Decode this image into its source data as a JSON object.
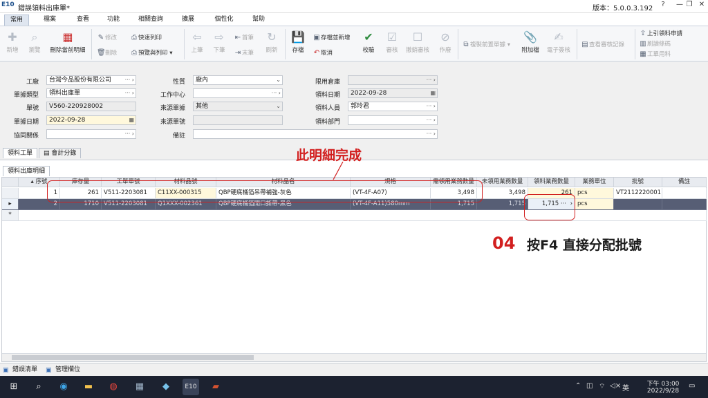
{
  "window": {
    "app_icon": "E10",
    "title": "錯誤領料出庫單*",
    "version": "版本：5.0.0.3.192",
    "controls": [
      "?",
      "—",
      "❐",
      "✕"
    ]
  },
  "ribbon_tabs": [
    "常用",
    "檔案",
    "查看",
    "功能",
    "相關查詢",
    "擴展",
    "個性化",
    "幫助"
  ],
  "toolbar": {
    "new": "新增",
    "browse": "瀏覽",
    "delete_current_detail": "刪除當前明細",
    "modify": "修改",
    "delete": "刪除",
    "quick_print": "快速列印",
    "preview_print": "預覽與列印",
    "prev": "上筆",
    "next": "下筆",
    "first": "首筆",
    "last": "末筆",
    "refresh": "刷新",
    "save": "存檔",
    "save_and_new": "存檔並新增",
    "cancel": "取消",
    "validate": "校驗",
    "review": "審核",
    "unreview": "撤銷審核",
    "void": "作廢",
    "copy_prev_doc": "複製前置單據",
    "attachment": "附加檔",
    "e_sign": "電子簽核",
    "view_review_log": "查看審核記錄",
    "prev_requisition": "上引領料申請",
    "scan_code": "刷讀條碼",
    "work_materials": "工單用料"
  },
  "form": {
    "factory_label": "工廠",
    "factory_value": "台灣今品股份有限公司",
    "doc_type_label": "單據類型",
    "doc_type_value": "領料出庫單",
    "doc_no_label": "單號",
    "doc_no_value": "V560-220928002",
    "doc_date_label": "單據日期",
    "doc_date_value": "2022-09-28",
    "co_label": "協同關係",
    "co_value": "",
    "nature_label": "性質",
    "nature_value": "廠內",
    "work_center_label": "工作中心",
    "work_center_value": "",
    "source_type_label": "來源單據",
    "source_type_value": "其他",
    "source_no_label": "來源單號",
    "source_no_value": "",
    "remark_label": "備註",
    "remark_value": "",
    "warehouse_label": "限用倉庫",
    "warehouse_value": "",
    "pick_date_label": "領料日期",
    "pick_date_value": "2022-09-28",
    "picker_label": "領料人員",
    "picker_value": "郭玲君",
    "pick_dept_label": "領料部門",
    "pick_dept_value": ""
  },
  "subtabs": [
    "領料工單",
    "會計分錄"
  ],
  "detail_tab": "領料出庫明細",
  "grid": {
    "columns": [
      "序號",
      "庫存量",
      "工單單號",
      "材料品號",
      "材料品名",
      "規格",
      "需領用業務數量",
      "未領用業務數量",
      "領料業務數量",
      "業務單位",
      "批號",
      "備註"
    ],
    "rows": [
      {
        "seq": "1",
        "stock": "261",
        "work_order": "V511-2203081",
        "item_no": "C11XX-000315",
        "item_name": "QBP硬底桶箔吊帶補強-灰色",
        "spec": "(VT-4F-A07)",
        "need_qty": "3,498",
        "pending_qty": "3,498",
        "pick_qty": "261",
        "unit": "pcs",
        "lot": "VT2112220001",
        "remark": ""
      },
      {
        "seq": "2",
        "stock": "1710",
        "work_order": "V511-2203081",
        "item_no": "Q1XXX-002361",
        "item_name": "QBP硬底桶箔開口撕帶-黑色",
        "spec": "(VT-4F-A11)580mm",
        "need_qty": "1,715",
        "pending_qty": "1,715",
        "pick_qty": "1,715",
        "unit": "pcs",
        "lot": "",
        "remark": ""
      }
    ]
  },
  "bottom_tabs": [
    "錯誤清單",
    "管理欄位"
  ],
  "annotations": {
    "done": "此明細完成",
    "step": "04",
    "step_text": "按F4 直接分配批號"
  },
  "taskbar": {
    "ime": "英",
    "time": "下午 03:00",
    "date": "2022/9/28"
  },
  "colors": {
    "annotation": "#d21f1f",
    "selected_row": "#575e75",
    "editable_cell": "#fff8dc",
    "taskbar": "#1c2230"
  }
}
